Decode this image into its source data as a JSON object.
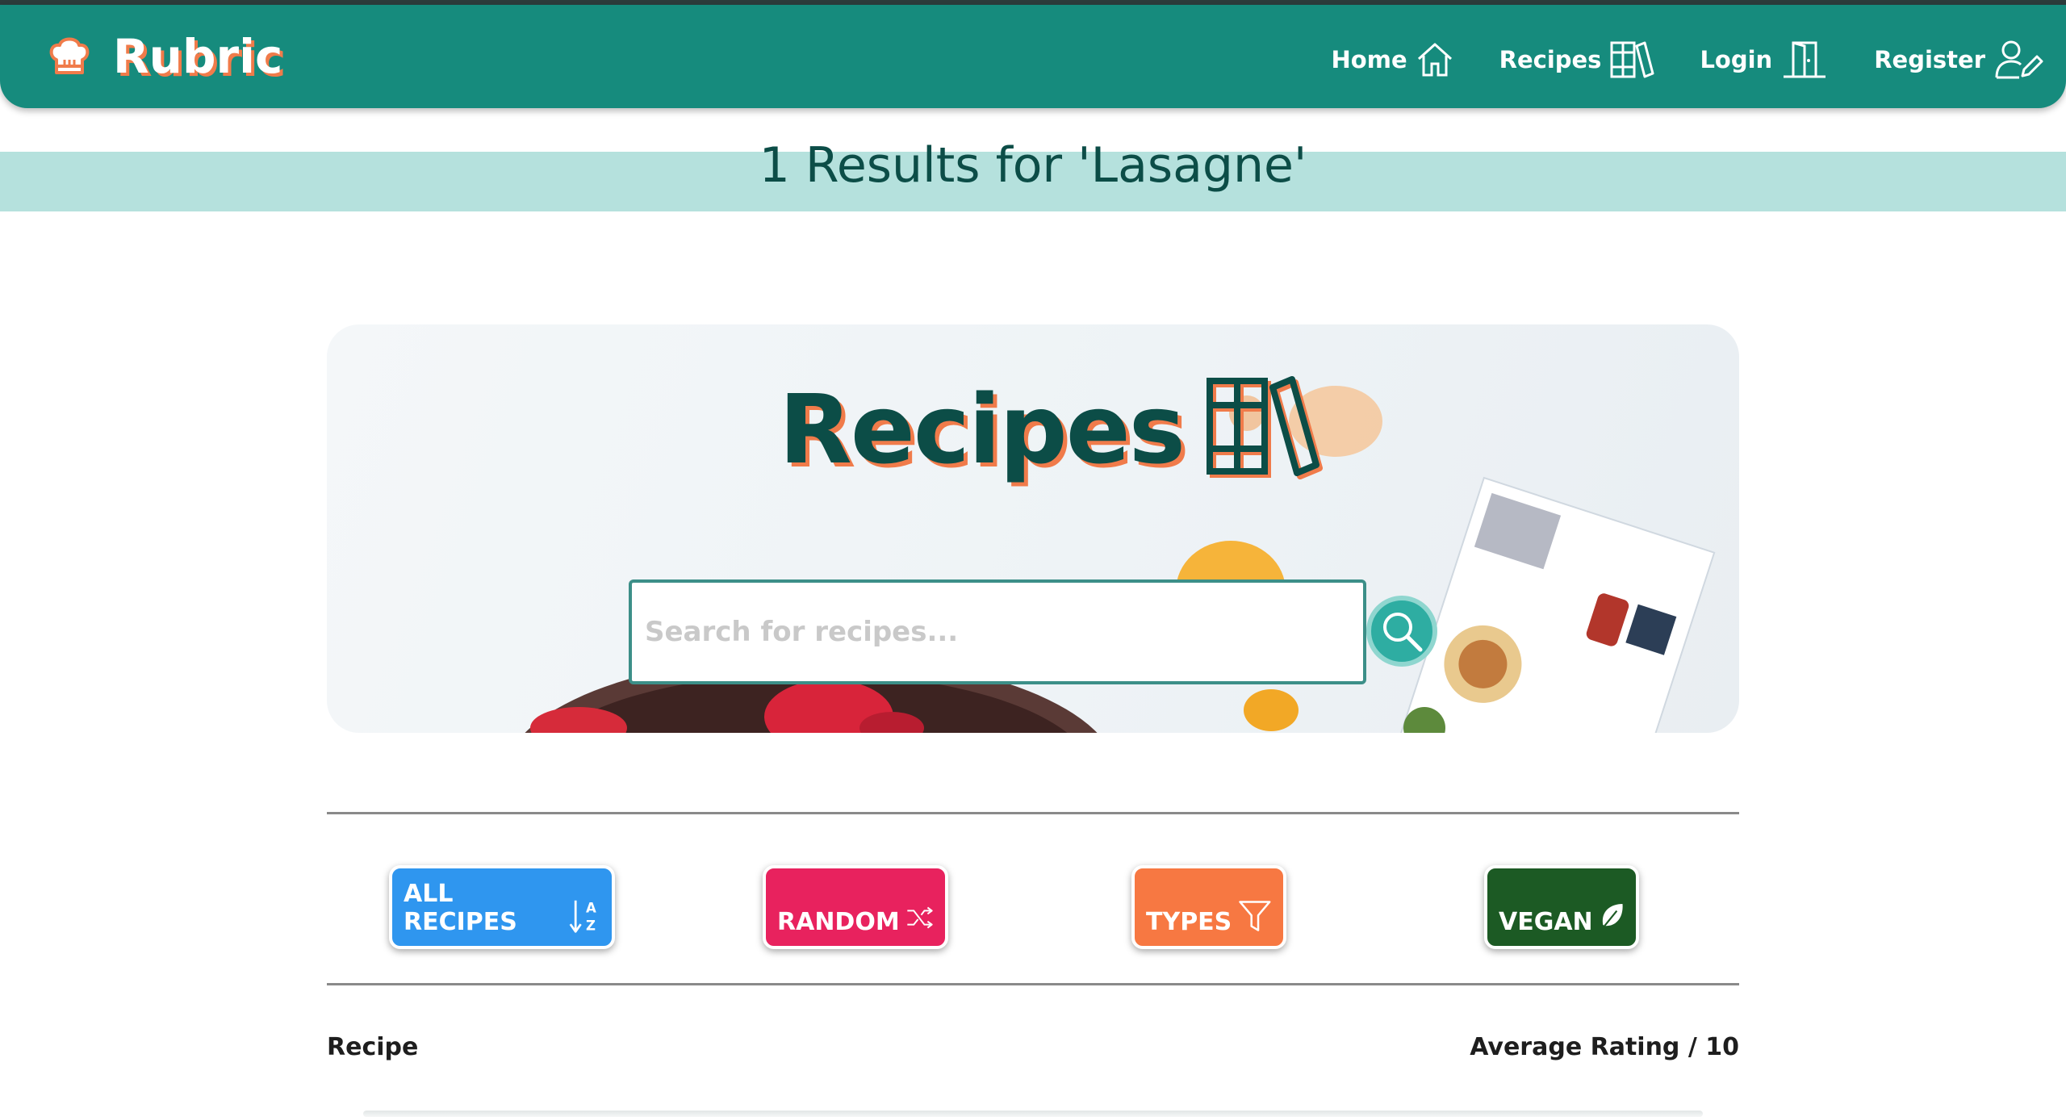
{
  "navbar": {
    "brand": "Rubric",
    "links": [
      {
        "label": "Home",
        "icon": "home-icon"
      },
      {
        "label": "Recipes",
        "icon": "books-icon"
      },
      {
        "label": "Login",
        "icon": "door-icon"
      },
      {
        "label": "Register",
        "icon": "user-edit-icon"
      }
    ]
  },
  "results": {
    "text": "1 Results for 'Lasagne'"
  },
  "hero": {
    "title": "Recipes",
    "title_icon": "books-icon",
    "search_placeholder": "Search for recipes...",
    "search_icon": "search-icon"
  },
  "categories": [
    {
      "label": "ALL RECIPES",
      "icon": "sort-alpha-down-icon",
      "color": "#2f96ef"
    },
    {
      "label": "RANDOM",
      "icon": "shuffle-icon",
      "color": "#e8225e"
    },
    {
      "label": "TYPES",
      "icon": "filter-icon",
      "color": "#f77842"
    },
    {
      "label": "VEGAN",
      "icon": "leaf-icon",
      "color": "#1c5a24"
    }
  ],
  "table": {
    "col_recipe": "Recipe",
    "col_rating": "Average Rating / 10"
  },
  "colors": {
    "nav_teal": "#168b7d",
    "dark_teal": "#0c4d47",
    "accent_orange": "#f07b4a",
    "results_bg": "#b5e1dd"
  }
}
